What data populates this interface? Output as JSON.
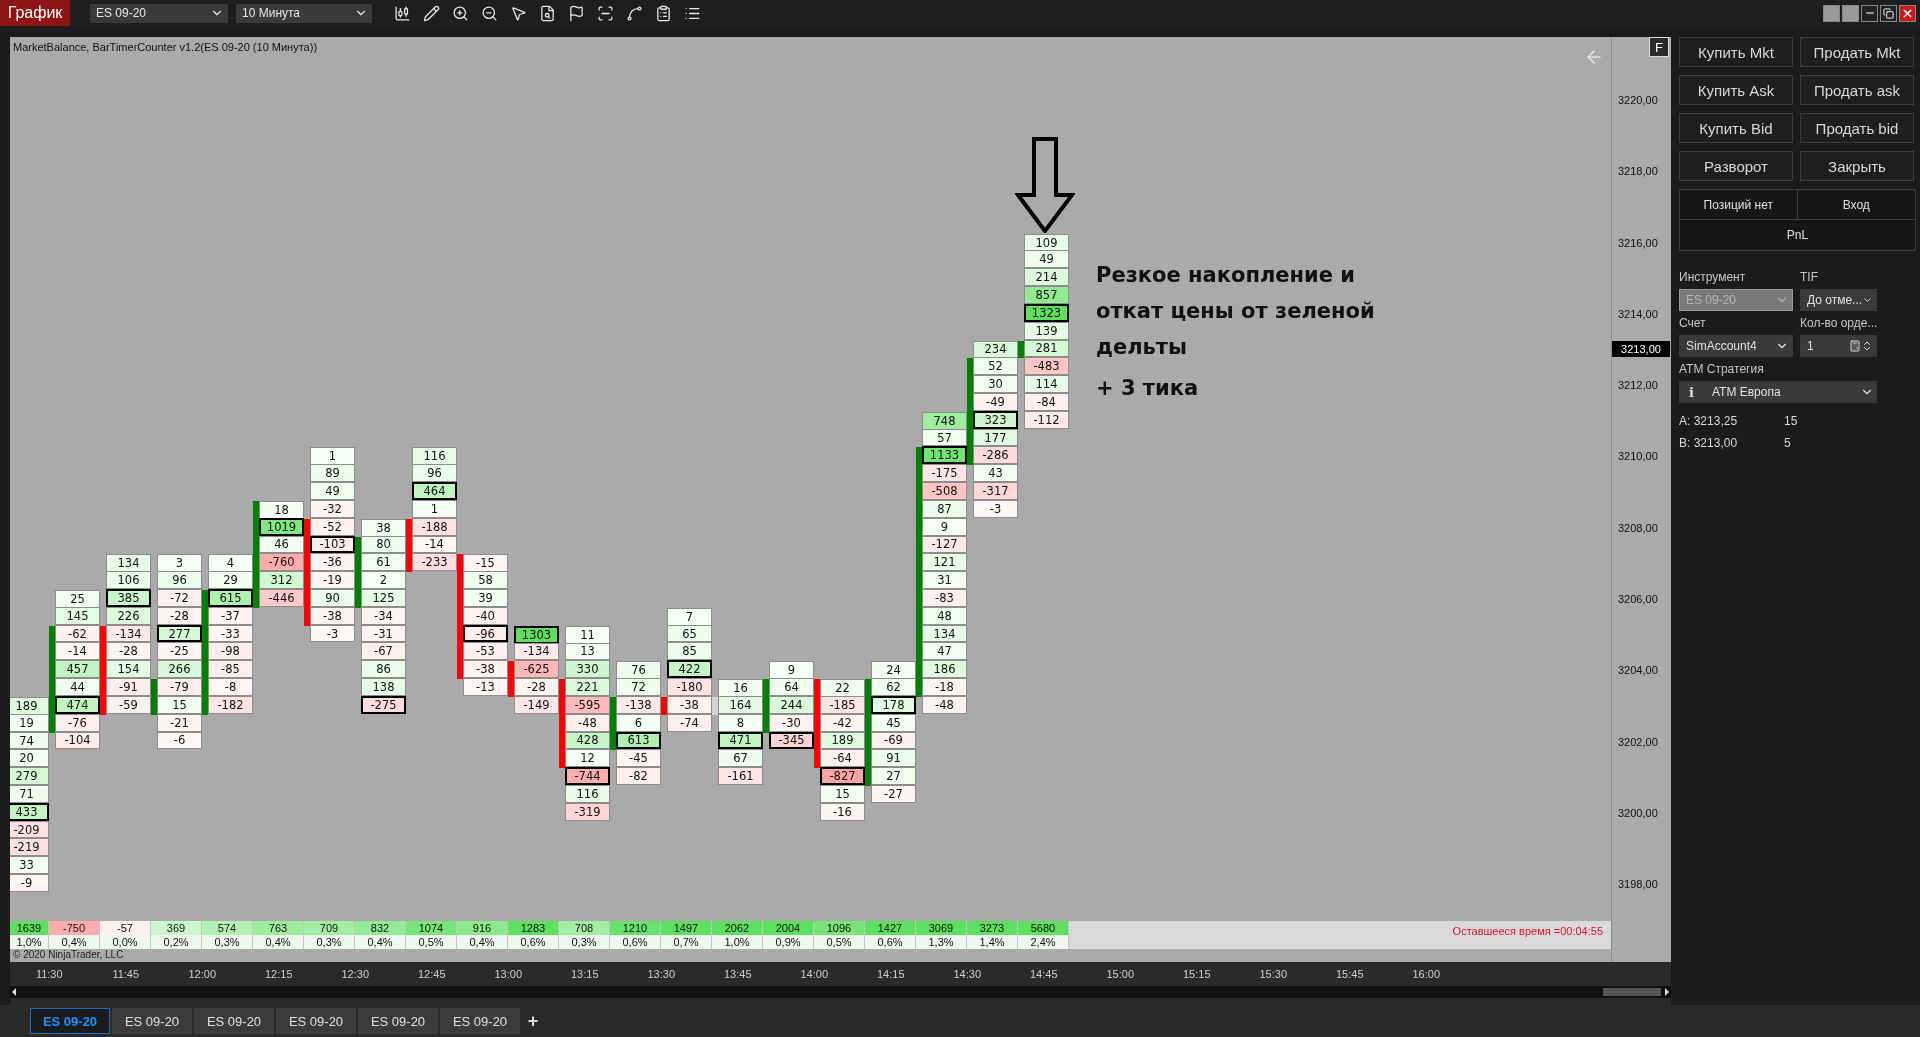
{
  "toolbar": {
    "title_tab": "График",
    "instrument": "ES 09-20",
    "interval": "10 Минута"
  },
  "chart": {
    "header": "MarketBalance, BarTimerCounter v1.2(ES 09-20 (10 Минута))",
    "f_button": "F",
    "price_axis": [
      "3220,00",
      "3218,00",
      "3216,00",
      "3214,00",
      "3212,00",
      "3210,00",
      "3208,00",
      "3206,00",
      "3204,00",
      "3202,00",
      "3200,00",
      "3198,00"
    ],
    "current_price": "3213,00",
    "bars": [
      {
        "cells": [
          {
            "value": "189",
            "poc": false,
            "body": false
          },
          {
            "value": "19",
            "poc": false,
            "body": false
          },
          {
            "value": "74",
            "poc": false,
            "body": false
          },
          {
            "value": "20",
            "poc": false,
            "body": false
          },
          {
            "value": "279",
            "poc": false,
            "body": false
          },
          {
            "value": "71",
            "poc": false,
            "body": false
          },
          {
            "value": "433",
            "poc": true,
            "body": false
          },
          {
            "value": "-209",
            "poc": false,
            "body": false
          },
          {
            "value": "-219",
            "poc": false,
            "body": false
          },
          {
            "value": "33",
            "poc": false,
            "body": false
          },
          {
            "value": "-9",
            "poc": false,
            "body": false
          }
        ]
      },
      {
        "color": "#008000",
        "cells": [
          {
            "value": "25",
            "poc": false,
            "body": false
          },
          {
            "value": "145",
            "poc": false,
            "body": false
          },
          {
            "value": "-62",
            "poc": false,
            "body": true
          },
          {
            "value": "-14",
            "poc": false,
            "body": true
          },
          {
            "value": "457",
            "poc": false,
            "body": true
          },
          {
            "value": "44",
            "poc": false,
            "body": true
          },
          {
            "value": "474",
            "poc": true,
            "body": true
          },
          {
            "value": "-76",
            "poc": false,
            "body": true
          },
          {
            "value": "-104",
            "poc": false,
            "body": false
          }
        ]
      },
      {
        "color": "#ff0000",
        "cells": [
          {
            "value": "134",
            "poc": false,
            "body": false
          },
          {
            "value": "106",
            "poc": false,
            "body": false
          },
          {
            "value": "385",
            "poc": true,
            "body": false
          },
          {
            "value": "226",
            "poc": false,
            "body": false
          },
          {
            "value": "-134",
            "poc": false,
            "body": true
          },
          {
            "value": "-28",
            "poc": false,
            "body": true
          },
          {
            "value": "154",
            "poc": false,
            "body": true
          },
          {
            "value": "-91",
            "poc": false,
            "body": true
          },
          {
            "value": "-59",
            "poc": false,
            "body": true
          }
        ]
      },
      {
        "color": "#008000",
        "cells": [
          {
            "value": "3",
            "poc": false,
            "body": false
          },
          {
            "value": "96",
            "poc": false,
            "body": false
          },
          {
            "value": "-72",
            "poc": false,
            "body": false
          },
          {
            "value": "-28",
            "poc": false,
            "body": false
          },
          {
            "value": "277",
            "poc": true,
            "body": false
          },
          {
            "value": "-25",
            "poc": false,
            "body": false
          },
          {
            "value": "266",
            "poc": false,
            "body": false
          },
          {
            "value": "-79",
            "poc": false,
            "body": true
          },
          {
            "value": "15",
            "poc": false,
            "body": true
          },
          {
            "value": "-21",
            "poc": false,
            "body": false
          },
          {
            "value": "-6",
            "poc": false,
            "body": false
          }
        ]
      },
      {
        "color": "#008000",
        "cells": [
          {
            "value": "4",
            "poc": false,
            "body": false
          },
          {
            "value": "29",
            "poc": false,
            "body": false
          },
          {
            "value": "615",
            "poc": true,
            "body": true
          },
          {
            "value": "-37",
            "poc": false,
            "body": true
          },
          {
            "value": "-33",
            "poc": false,
            "body": true
          },
          {
            "value": "-98",
            "poc": false,
            "body": true
          },
          {
            "value": "-85",
            "poc": false,
            "body": true
          },
          {
            "value": "-8",
            "poc": false,
            "body": true
          },
          {
            "value": "-182",
            "poc": false,
            "body": true
          }
        ]
      },
      {
        "color": "#008000",
        "cells": [
          {
            "value": "18",
            "poc": false,
            "body": true
          },
          {
            "value": "1019",
            "poc": true,
            "body": true
          },
          {
            "value": "46",
            "poc": false,
            "body": true
          },
          {
            "value": "-760",
            "poc": false,
            "body": true
          },
          {
            "value": "312",
            "poc": false,
            "body": true
          },
          {
            "value": "-446",
            "poc": false,
            "body": true
          }
        ]
      },
      {
        "color": "#ff0000",
        "cells": [
          {
            "value": "1",
            "poc": false,
            "body": false
          },
          {
            "value": "89",
            "poc": false,
            "body": false
          },
          {
            "value": "49",
            "poc": false,
            "body": false
          },
          {
            "value": "-32",
            "poc": false,
            "body": false
          },
          {
            "value": "-52",
            "poc": false,
            "body": true
          },
          {
            "value": "-103",
            "poc": true,
            "body": true
          },
          {
            "value": "-36",
            "poc": false,
            "body": true
          },
          {
            "value": "-19",
            "poc": false,
            "body": true
          },
          {
            "value": "90",
            "poc": false,
            "body": true
          },
          {
            "value": "-38",
            "poc": false,
            "body": true
          },
          {
            "value": "-3",
            "poc": false,
            "body": false
          }
        ]
      },
      {
        "color": "#008000",
        "cells": [
          {
            "value": "38",
            "poc": false,
            "body": false
          },
          {
            "value": "80",
            "poc": false,
            "body": true
          },
          {
            "value": "61",
            "poc": false,
            "body": true
          },
          {
            "value": "2",
            "poc": false,
            "body": true
          },
          {
            "value": "125",
            "poc": false,
            "body": true
          },
          {
            "value": "-34",
            "poc": false,
            "body": false
          },
          {
            "value": "-31",
            "poc": false,
            "body": false
          },
          {
            "value": "-67",
            "poc": false,
            "body": false
          },
          {
            "value": "86",
            "poc": false,
            "body": false
          },
          {
            "value": "138",
            "poc": false,
            "body": false
          },
          {
            "value": "-275",
            "poc": true,
            "body": false
          }
        ]
      },
      {
        "color": "#ff0000",
        "cells": [
          {
            "value": "116",
            "poc": false,
            "body": false
          },
          {
            "value": "96",
            "poc": false,
            "body": false
          },
          {
            "value": "464",
            "poc": true,
            "body": false
          },
          {
            "value": "1",
            "poc": false,
            "body": false
          },
          {
            "value": "-188",
            "poc": false,
            "body": true
          },
          {
            "value": "-14",
            "poc": false,
            "body": true
          },
          {
            "value": "-233",
            "poc": false,
            "body": true
          }
        ]
      },
      {
        "color": "#ff0000",
        "cells": [
          {
            "value": "-15",
            "poc": false,
            "body": true
          },
          {
            "value": "58",
            "poc": false,
            "body": true
          },
          {
            "value": "39",
            "poc": false,
            "body": true
          },
          {
            "value": "-40",
            "poc": false,
            "body": true
          },
          {
            "value": "-96",
            "poc": true,
            "body": true
          },
          {
            "value": "-53",
            "poc": false,
            "body": true
          },
          {
            "value": "-38",
            "poc": false,
            "body": true
          },
          {
            "value": "-13",
            "poc": false,
            "body": false
          }
        ]
      },
      {
        "color": "#ff0000",
        "cells": [
          {
            "value": "1303",
            "poc": true,
            "body": false
          },
          {
            "value": "-134",
            "poc": false,
            "body": false
          },
          {
            "value": "-625",
            "poc": false,
            "body": true
          },
          {
            "value": "-28",
            "poc": false,
            "body": true
          },
          {
            "value": "-149",
            "poc": false,
            "body": false
          }
        ]
      },
      {
        "color": "#ff0000",
        "cells": [
          {
            "value": "11",
            "poc": false,
            "body": false
          },
          {
            "value": "13",
            "poc": false,
            "body": false
          },
          {
            "value": "330",
            "poc": false,
            "body": false
          },
          {
            "value": "221",
            "poc": false,
            "body": true
          },
          {
            "value": "-595",
            "poc": false,
            "body": true
          },
          {
            "value": "-48",
            "poc": false,
            "body": true
          },
          {
            "value": "428",
            "poc": false,
            "body": true
          },
          {
            "value": "12",
            "poc": false,
            "body": true
          },
          {
            "value": "-744",
            "poc": true,
            "body": false
          },
          {
            "value": "116",
            "poc": false,
            "body": false
          },
          {
            "value": "-319",
            "poc": false,
            "body": false
          }
        ]
      },
      {
        "color": "#008000",
        "cells": [
          {
            "value": "76",
            "poc": false,
            "body": false
          },
          {
            "value": "72",
            "poc": false,
            "body": false
          },
          {
            "value": "-138",
            "poc": false,
            "body": true
          },
          {
            "value": "6",
            "poc": false,
            "body": true
          },
          {
            "value": "613",
            "poc": true,
            "body": true
          },
          {
            "value": "-45",
            "poc": false,
            "body": false
          },
          {
            "value": "-82",
            "poc": false,
            "body": false
          }
        ]
      },
      {
        "color": "#ff0000",
        "cells": [
          {
            "value": "7",
            "poc": false,
            "body": false
          },
          {
            "value": "65",
            "poc": false,
            "body": false
          },
          {
            "value": "85",
            "poc": false,
            "body": false
          },
          {
            "value": "422",
            "poc": true,
            "body": false
          },
          {
            "value": "-180",
            "poc": false,
            "body": false
          },
          {
            "value": "-38",
            "poc": false,
            "body": true
          },
          {
            "value": "-74",
            "poc": false,
            "body": false
          }
        ]
      },
      {
        "color": "#d4d4d4",
        "cells": [
          {
            "value": "16",
            "poc": false,
            "body": false
          },
          {
            "value": "164",
            "poc": false,
            "body": true
          },
          {
            "value": "8",
            "poc": false,
            "body": false
          },
          {
            "value": "471",
            "poc": true,
            "body": false
          },
          {
            "value": "67",
            "poc": false,
            "body": false
          },
          {
            "value": "-161",
            "poc": false,
            "body": false
          }
        ]
      },
      {
        "color": "#008000",
        "cells": [
          {
            "value": "9",
            "poc": false,
            "body": false
          },
          {
            "value": "64",
            "poc": false,
            "body": true
          },
          {
            "value": "244",
            "poc": false,
            "body": true
          },
          {
            "value": "-30",
            "poc": false,
            "body": true
          },
          {
            "value": "-345",
            "poc": true,
            "body": false
          }
        ]
      },
      {
        "color": "#ff0000",
        "cells": [
          {
            "value": "22",
            "poc": false,
            "body": true
          },
          {
            "value": "-185",
            "poc": false,
            "body": true
          },
          {
            "value": "-42",
            "poc": false,
            "body": true
          },
          {
            "value": "189",
            "poc": false,
            "body": true
          },
          {
            "value": "-64",
            "poc": false,
            "body": true
          },
          {
            "value": "-827",
            "poc": true,
            "body": false
          },
          {
            "value": "15",
            "poc": false,
            "body": false
          },
          {
            "value": "-16",
            "poc": false,
            "body": false
          }
        ]
      },
      {
        "color": "#008000",
        "cells": [
          {
            "value": "24",
            "poc": false,
            "body": false
          },
          {
            "value": "62",
            "poc": false,
            "body": true
          },
          {
            "value": "178",
            "poc": true,
            "body": true
          },
          {
            "value": "45",
            "poc": false,
            "body": true
          },
          {
            "value": "-69",
            "poc": false,
            "body": true
          },
          {
            "value": "91",
            "poc": false,
            "body": true
          },
          {
            "value": "27",
            "poc": false,
            "body": true
          },
          {
            "value": "-27",
            "poc": false,
            "body": false
          }
        ]
      },
      {
        "color": "#008000",
        "cells": [
          {
            "value": "748",
            "poc": false,
            "body": false
          },
          {
            "value": "57",
            "poc": false,
            "body": false
          },
          {
            "value": "1133",
            "poc": true,
            "body": true
          },
          {
            "value": "-175",
            "poc": false,
            "body": true
          },
          {
            "value": "-508",
            "poc": false,
            "body": true
          },
          {
            "value": "87",
            "poc": false,
            "body": true
          },
          {
            "value": "9",
            "poc": false,
            "body": true
          },
          {
            "value": "-127",
            "poc": false,
            "body": true
          },
          {
            "value": "121",
            "poc": false,
            "body": true
          },
          {
            "value": "31",
            "poc": false,
            "body": true
          },
          {
            "value": "-83",
            "poc": false,
            "body": true
          },
          {
            "value": "48",
            "poc": false,
            "body": true
          },
          {
            "value": "134",
            "poc": false,
            "body": true
          },
          {
            "value": "47",
            "poc": false,
            "body": true
          },
          {
            "value": "186",
            "poc": false,
            "body": true
          },
          {
            "value": "-18",
            "poc": false,
            "body": true
          },
          {
            "value": "-48",
            "poc": false,
            "body": false
          }
        ]
      },
      {
        "color": "#008000",
        "cells": [
          {
            "value": "234",
            "poc": false,
            "body": false
          },
          {
            "value": "52",
            "poc": false,
            "body": true
          },
          {
            "value": "30",
            "poc": false,
            "body": true
          },
          {
            "value": "-49",
            "poc": false,
            "body": true
          },
          {
            "value": "323",
            "poc": true,
            "body": true
          },
          {
            "value": "177",
            "poc": false,
            "body": true
          },
          {
            "value": "-286",
            "poc": false,
            "body": true
          },
          {
            "value": "43",
            "poc": false,
            "body": false
          },
          {
            "value": "-317",
            "poc": false,
            "body": false
          },
          {
            "value": "-3",
            "poc": false,
            "body": false
          }
        ]
      },
      {
        "color": "#008000",
        "cells": [
          {
            "value": "109",
            "poc": false,
            "body": false
          },
          {
            "value": "49",
            "poc": false,
            "body": false
          },
          {
            "value": "214",
            "poc": false,
            "body": false
          },
          {
            "value": "857",
            "poc": false,
            "body": false
          },
          {
            "value": "1323",
            "poc": true,
            "body": false
          },
          {
            "value": "139",
            "poc": false,
            "body": false
          },
          {
            "value": "281",
            "poc": false,
            "body": true
          },
          {
            "value": "-483",
            "poc": false,
            "body": false
          },
          {
            "value": "114",
            "poc": false,
            "body": false
          },
          {
            "value": "-84",
            "poc": false,
            "body": false
          },
          {
            "value": "-112",
            "poc": false,
            "body": false
          }
        ]
      }
    ],
    "annotation": {
      "lines": [
        "Резкое накопление и",
        "откат цены от зеленой",
        "дельты"
      ],
      "note": "+ 3 тика"
    },
    "summary": {
      "deltas": [
        "1639",
        "-750",
        "-57",
        "369",
        "574",
        "763",
        "709",
        "832",
        "1074",
        "916",
        "1283",
        "708",
        "1210",
        "1497",
        "2062",
        "2004",
        "1096",
        "1427",
        "3069",
        "3273",
        "5680"
      ],
      "percents": [
        "1,0%",
        "0,4%",
        "0,0%",
        "0,2%",
        "0,3%",
        "0,4%",
        "0,3%",
        "0,4%",
        "0,5%",
        "0,4%",
        "0,6%",
        "0,3%",
        "0,6%",
        "0,7%",
        "1,0%",
        "0,9%",
        "0,5%",
        "0,6%",
        "1,3%",
        "1,4%",
        "2,4%"
      ],
      "copyright": "© 2020 NinjaTrader, LLC",
      "timer": "Оставшееся время =00:04:55"
    },
    "time_axis": [
      "11:30",
      "11:45",
      "12:00",
      "12:15",
      "12:30",
      "12:45",
      "13:00",
      "13:15",
      "13:30",
      "13:45",
      "14:00",
      "14:15",
      "14:30",
      "14:45",
      "15:00",
      "15:15",
      "15:30",
      "15:45",
      "16:00"
    ]
  },
  "right_panel": {
    "buttons": [
      "Купить Mkt",
      "Продать Mkt",
      "Купить Ask",
      "Продать ask",
      "Купить Bid",
      "Продать bid",
      "Разворот",
      "Закрыть"
    ],
    "position": {
      "status": "Позиций нет",
      "entry": "Вход",
      "pnl": "PnL"
    },
    "instrument": {
      "label": "Инструмент",
      "value": "ES 09-20",
      "disabled": true
    },
    "tif": {
      "label": "TIF",
      "value": "До отме..."
    },
    "account": {
      "label": "Счет",
      "value": "SimAccount4"
    },
    "quantity": {
      "label": "Кол-во орде...",
      "value": "1"
    },
    "atm": {
      "label": "ATM Стратегия",
      "info": "i",
      "value": "ATM Европа"
    },
    "quotes": [
      {
        "label": "A:",
        "price": "3213,25",
        "size": "15"
      },
      {
        "label": "B:",
        "price": "3213,00",
        "size": "5"
      }
    ]
  },
  "tabs": [
    {
      "label": "ES 09-20",
      "selected": true
    },
    {
      "label": "ES 09-20",
      "selected": false
    },
    {
      "label": "ES 09-20",
      "selected": false
    },
    {
      "label": "ES 09-20",
      "selected": false
    },
    {
      "label": "ES 09-20",
      "selected": false
    },
    {
      "label": "ES 09-20",
      "selected": false
    }
  ],
  "add_tab": "+"
}
